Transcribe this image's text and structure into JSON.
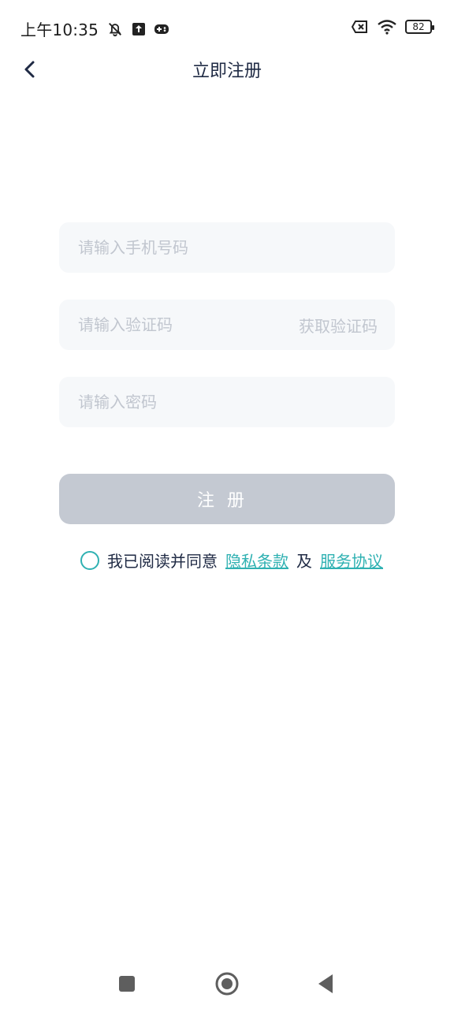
{
  "status_bar": {
    "time": "上午10:35",
    "battery": "82"
  },
  "header": {
    "title": "立即注册"
  },
  "form": {
    "phone_placeholder": "请输入手机号码",
    "code_placeholder": "请输入验证码",
    "get_code_label": "获取验证码",
    "password_placeholder": "请输入密码",
    "submit_label": "注册"
  },
  "agreement": {
    "prefix": "我已阅读并同意",
    "privacy_label": "隐私条款",
    "and": "及",
    "service_label": "服务协议"
  },
  "colors": {
    "accent": "#2fb1b2",
    "button_disabled": "#c4c9d2",
    "input_bg": "#f6f8fa"
  }
}
